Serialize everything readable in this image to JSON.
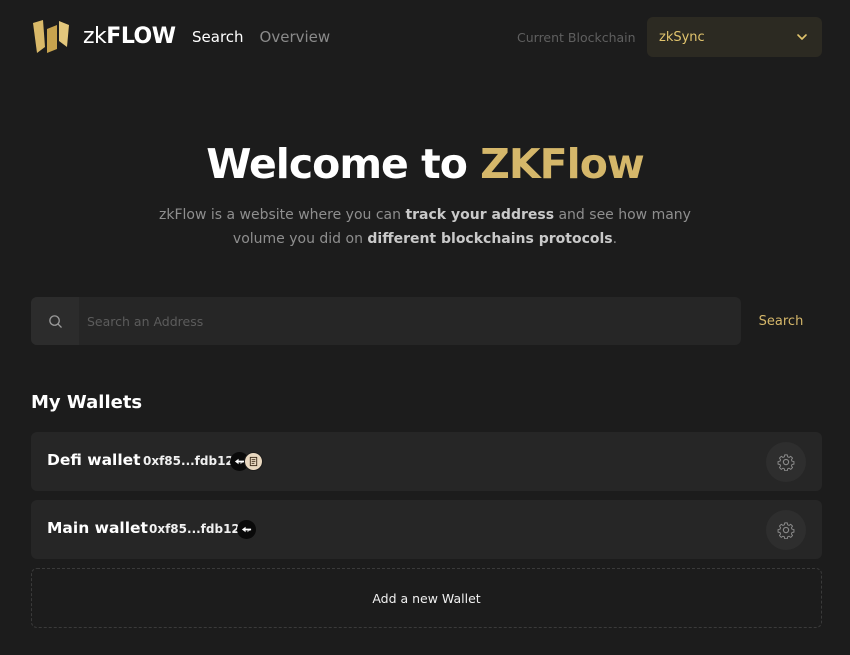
{
  "brand": {
    "name_prefix": "zk",
    "name_suffix": "FLOW"
  },
  "nav": {
    "items": [
      {
        "label": "Search",
        "active": true
      },
      {
        "label": "Overview",
        "active": false
      }
    ]
  },
  "chain_selector": {
    "label": "Current Blockchain",
    "value": "zkSync"
  },
  "hero": {
    "title_prefix": "Welcome to ",
    "title_accent": "ZKFlow",
    "desc_part1": "zkFlow is a website where you can ",
    "desc_bold1": "track your address",
    "desc_part2": " and see how many volume you did on ",
    "desc_bold2": "different blockchains protocols",
    "desc_end": "."
  },
  "search": {
    "placeholder": "Search an Address",
    "button_label": "Search"
  },
  "wallets": {
    "title": "My Wallets",
    "items": [
      {
        "name": "Defi wallet",
        "address": "0xf85...fdb12",
        "protocols": [
          "swap-icon",
          "document-icon"
        ]
      },
      {
        "name": "Main wallet",
        "address": "0xf85...fdb12",
        "protocols": [
          "swap-icon"
        ]
      }
    ],
    "add_label": "Add a new Wallet"
  },
  "colors": {
    "accent": "#d5b76a",
    "background": "#1c1c1c",
    "card": "#262626"
  }
}
